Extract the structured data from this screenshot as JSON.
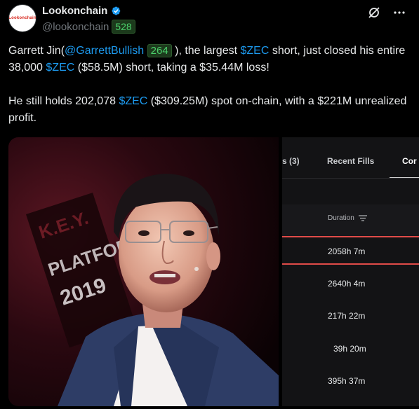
{
  "author": {
    "avatar_text": "Lookonchain",
    "display_name": "Lookonchain",
    "handle": "@lookonchain",
    "handle_badge": "528"
  },
  "icons": {
    "verified": "verified-badge-icon",
    "grok": "grok-icon",
    "more": "more-icon"
  },
  "tweet": {
    "p1_a": "Garrett Jin(",
    "p1_mention": "@GarrettBullish",
    "p1_badge": "264",
    "p1_b": " ), the largest ",
    "p1_cashtag1": "$ZEC",
    "p1_c": " short, just closed his entire 38,000 ",
    "p1_cashtag2": "$ZEC",
    "p1_d": " ($58.5M) short, taking a $35.44M loss!",
    "p2_a": "He still holds 202,078 ",
    "p2_cashtag": "$ZEC",
    "p2_b": " ($309.25M) spot on-chain, with a $221M unrealized profit."
  },
  "photo": {
    "banner_line1": "K.E.Y.",
    "banner_line2": "PLATFORM",
    "banner_line3": "2019"
  },
  "panel": {
    "tabs": [
      "s (3)",
      "Recent Fills",
      "Cor"
    ],
    "column_header": "Duration",
    "durations": [
      "2058h 7m",
      "2640h 4m",
      "217h 22m",
      "39h 20m",
      "395h 37m"
    ]
  },
  "colors": {
    "link": "#1d9bf0",
    "badge_green": "#4bd16b",
    "accent_red": "#e04b48"
  }
}
